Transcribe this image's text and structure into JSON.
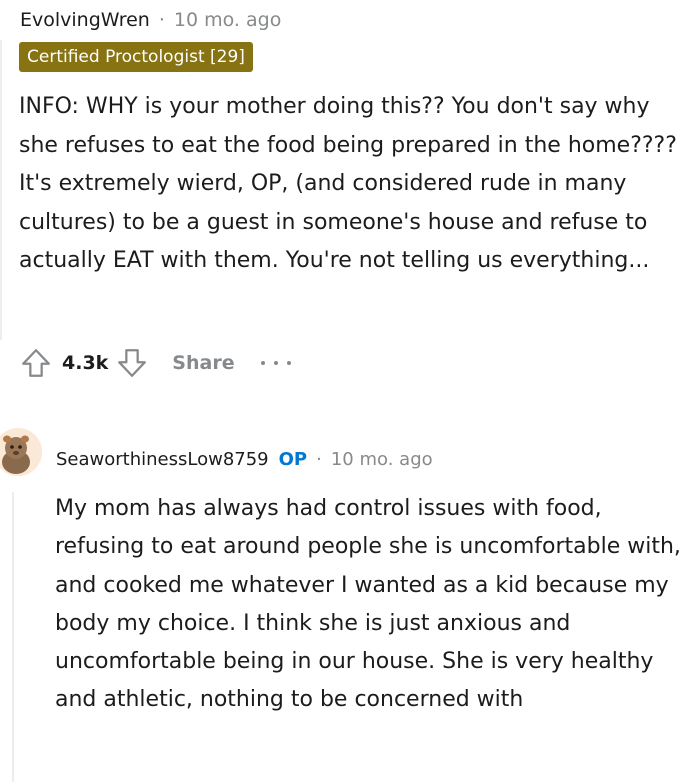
{
  "parent_comment": {
    "username": "EvolvingWren",
    "separator": "·",
    "timestamp": "10 mo. ago",
    "flair": "Certified Proctologist [29]",
    "body": "INFO: WHY is your mother doing this?? You don't say why she refuses to eat the food being prepared in the home???? It's extremely wierd, OP, (and considered rude in many cultures) to be a guest in someone's house and refuse to actually EAT with them. You're not telling us everything...",
    "actions": {
      "vote_count": "4.3k",
      "share_label": "Share",
      "upvote_icon": "arrow-up-outline-icon",
      "downvote_icon": "arrow-down-outline-icon",
      "more_icon": "ellipsis-icon"
    }
  },
  "reply": {
    "username": "SeaworthinessLow8759",
    "op_badge": "OP",
    "separator": "·",
    "timestamp": "10 mo. ago",
    "avatar_icon": "snoo-avatar-icon",
    "body": "My mom has always had control issues with food, refusing to eat around people she is uncomfortable with, and cooked me whatever I wanted as a kid because my body my choice. I think she is just anxious and uncomfortable being in our house. She is very healthy and athletic, nothing to be concerned with"
  },
  "colors": {
    "flair_bg": "#877312",
    "op_badge": "#0079d3",
    "meta_gray": "#878a8c",
    "text": "#1c1c1c"
  }
}
